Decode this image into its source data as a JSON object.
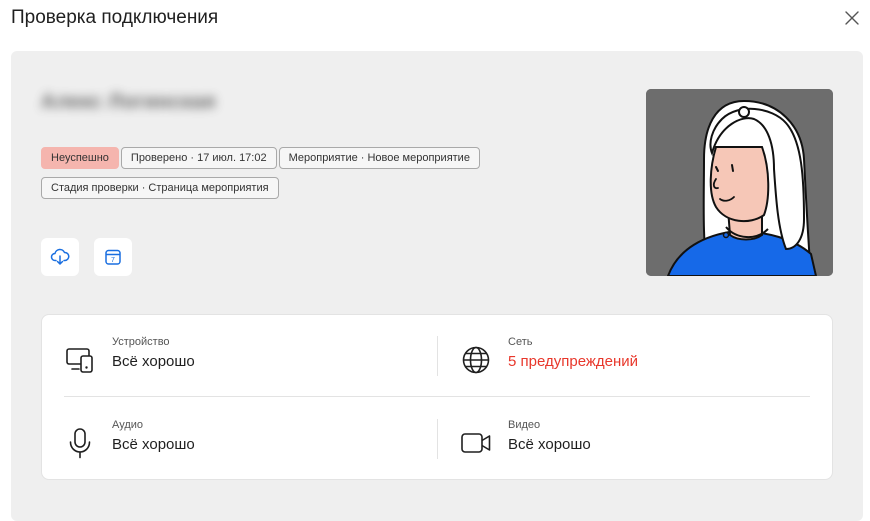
{
  "modal": {
    "title": "Проверка подключения",
    "close_icon": "close-icon"
  },
  "user": {
    "name": "Алекс Логинская"
  },
  "tags": [
    {
      "label": "Неуспешно",
      "status": "fail",
      "color": "#f5b5ae"
    },
    {
      "label": "Проверено · 17 июл. 17:02"
    },
    {
      "label": "Мероприятие · Новое мероприятие"
    },
    {
      "label": "Стадия проверки · Страница мероприятия"
    }
  ],
  "actions": [
    {
      "icon": "cloud-download-icon"
    },
    {
      "icon": "calendar-icon",
      "day": "7"
    }
  ],
  "checks": {
    "device": {
      "label": "Устройство",
      "value": "Всё хорошо",
      "icon": "devices-icon"
    },
    "network": {
      "label": "Сеть",
      "value": "5 предупреждений",
      "icon": "globe-icon",
      "color": "#e8372b"
    },
    "audio": {
      "label": "Аудио",
      "value": "Всё хорошо",
      "icon": "microphone-icon"
    },
    "video": {
      "label": "Видео",
      "value": "Всё хорошо",
      "icon": "video-camera-icon"
    }
  },
  "colors": {
    "panel_bg": "#efefef",
    "accent_blue": "#1a6fe0",
    "warning": "#e8372b"
  }
}
